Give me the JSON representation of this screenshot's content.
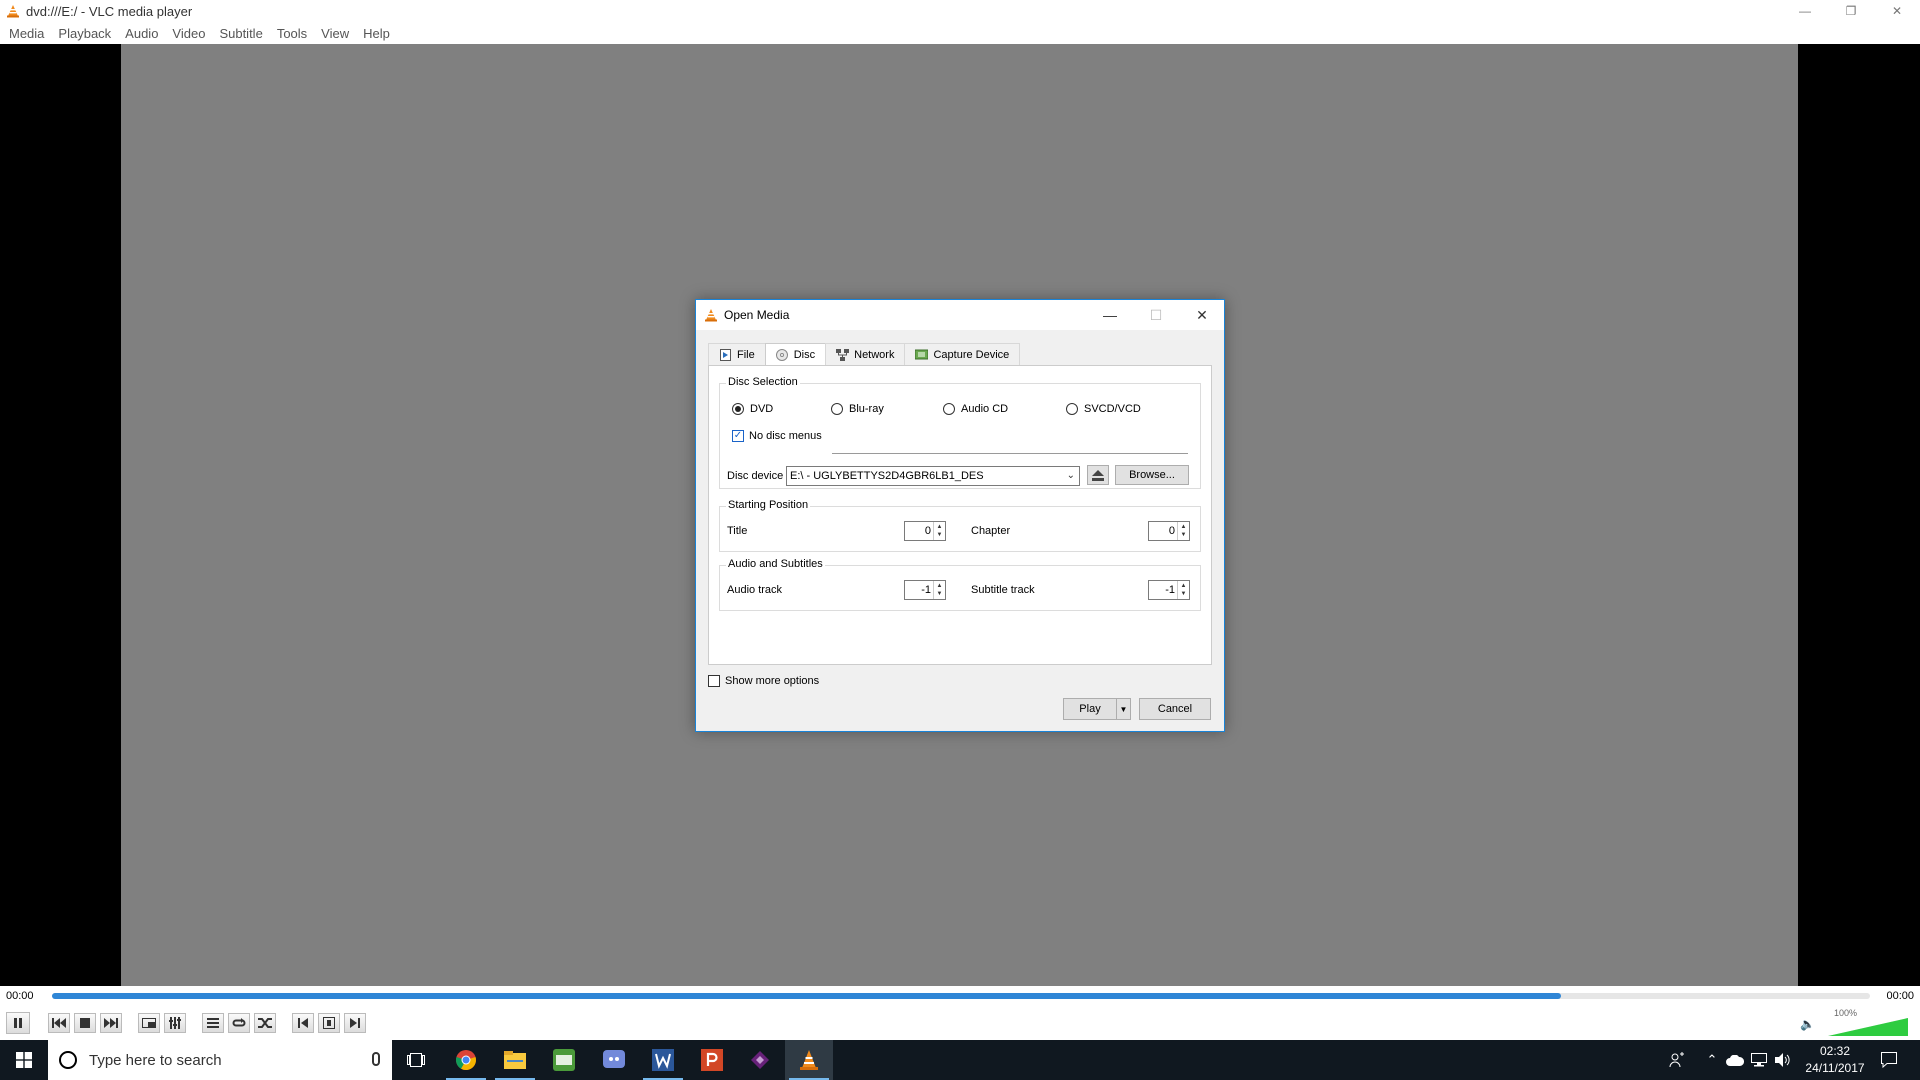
{
  "window": {
    "title": "dvd:///E:/ - VLC media player",
    "controls": [
      "minimize",
      "restore",
      "close"
    ]
  },
  "menu": [
    "Media",
    "Playback",
    "Audio",
    "Video",
    "Subtitle",
    "Tools",
    "View",
    "Help"
  ],
  "seek": {
    "elapsed": "00:00",
    "total": "00:00",
    "progress_fraction": 0.83
  },
  "controls": {
    "buttons": [
      "pause",
      "previous-chapter",
      "stop",
      "next-chapter",
      "fullscreen",
      "extended-settings",
      "playlist",
      "loop",
      "random",
      "frame-back",
      "frame-by-frame",
      "frame-forward"
    ],
    "volume": "100%"
  },
  "dialog": {
    "title": "Open Media",
    "tabs": [
      {
        "label": "File",
        "icon": "file-icon"
      },
      {
        "label": "Disc",
        "icon": "disc-icon"
      },
      {
        "label": "Network",
        "icon": "network-icon"
      },
      {
        "label": "Capture Device",
        "icon": "capture-device-icon"
      }
    ],
    "active_tab": "Disc",
    "disc_selection": {
      "label": "Disc Selection",
      "options": [
        "DVD",
        "Blu-ray",
        "Audio CD",
        "SVCD/VCD"
      ],
      "selected": "DVD",
      "no_menus_label": "No disc menus",
      "no_menus_checked": true,
      "device_label": "Disc device",
      "device_value": "E:\\ - UGLYBETTYS2D4GBR6LB1_DES",
      "browse_label": "Browse..."
    },
    "starting_position": {
      "label": "Starting Position",
      "title_label": "Title",
      "title_value": "0",
      "chapter_label": "Chapter",
      "chapter_value": "0"
    },
    "audio_subtitles": {
      "label": "Audio and Subtitles",
      "audio_label": "Audio track",
      "audio_value": "-1",
      "subtitle_label": "Subtitle track",
      "subtitle_value": "-1"
    },
    "show_more_label": "Show more options",
    "show_more_checked": false,
    "play_label": "Play",
    "cancel_label": "Cancel"
  },
  "taskbar": {
    "search_placeholder": "Type here to search",
    "apps": [
      "chrome-icon",
      "file-explorer-icon",
      "sky-go-icon",
      "discord-icon",
      "word-icon",
      "powerpoint-icon",
      "visual-studio-icon",
      "vlc-icon"
    ],
    "time": "02:32",
    "date": "24/11/2017"
  },
  "colors": {
    "accent": "#1883d7",
    "seek_fill": "#2f86d6",
    "vlc_orange": "#f08a1c",
    "taskbar": "#101820",
    "video_grey": "#808080"
  }
}
